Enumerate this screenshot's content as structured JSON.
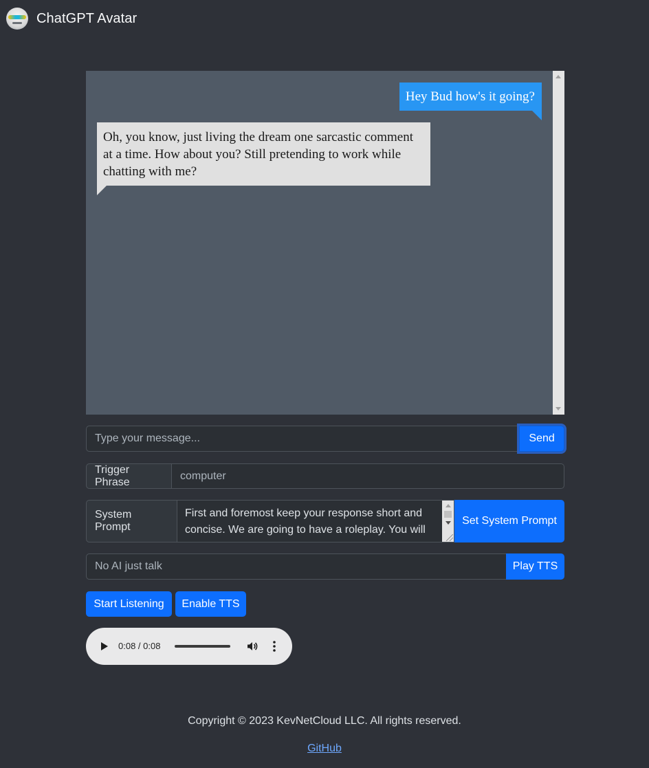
{
  "app": {
    "title": "ChatGPT Avatar"
  },
  "chat": {
    "messages": [
      {
        "role": "user",
        "text": "Hey Bud how's it going?"
      },
      {
        "role": "assistant",
        "text": "Oh, you know, just living the dream one sarcastic comment at a time. How about you? Still pretending to work while chatting with me?"
      }
    ]
  },
  "message_input": {
    "placeholder": "Type your message...",
    "value": ""
  },
  "send_button": {
    "label": "Send"
  },
  "trigger": {
    "label": "Trigger Phrase",
    "placeholder": "computer",
    "value": ""
  },
  "system_prompt": {
    "label": "System Prompt",
    "value": "First and foremost keep your response short and concise. We are going to have a roleplay. You will",
    "button_label": "Set System Prompt"
  },
  "tts": {
    "placeholder": "No AI just talk",
    "value": "",
    "button_label": "Play TTS"
  },
  "buttons": {
    "start_listening": "Start Listening",
    "enable_tts": "Enable TTS"
  },
  "audio": {
    "time_display": "0:08 / 0:08",
    "progress": 1.0
  },
  "footer": {
    "copyright": "Copyright © 2023 KevNetCloud LLC. All rights reserved.",
    "link_text": "GitHub"
  },
  "colors": {
    "background": "#2e3138",
    "chat_background": "#505a66",
    "user_bubble": "#2896f3",
    "assistant_bubble": "#e0e0e0",
    "primary_button": "#0d6efd",
    "link": "#6ea8fe"
  },
  "icons": {
    "logo": "robot-avatar-icon",
    "play": "play-icon",
    "volume": "volume-icon",
    "more": "more-vertical-icon"
  }
}
